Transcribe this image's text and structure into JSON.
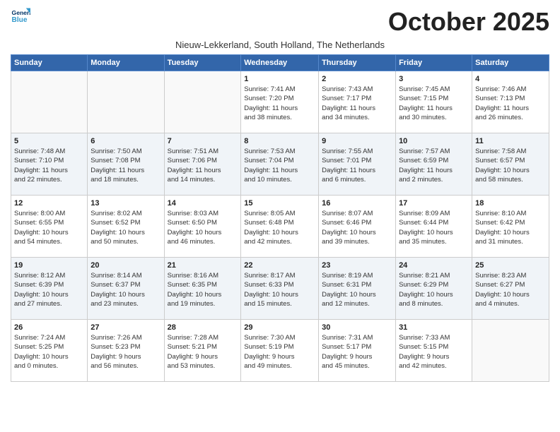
{
  "header": {
    "logo_line1": "General",
    "logo_line2": "Blue",
    "month": "October 2025",
    "subtitle": "Nieuw-Lekkerland, South Holland, The Netherlands"
  },
  "weekdays": [
    "Sunday",
    "Monday",
    "Tuesday",
    "Wednesday",
    "Thursday",
    "Friday",
    "Saturday"
  ],
  "weeks": [
    [
      {
        "day": "",
        "info": ""
      },
      {
        "day": "",
        "info": ""
      },
      {
        "day": "",
        "info": ""
      },
      {
        "day": "1",
        "info": "Sunrise: 7:41 AM\nSunset: 7:20 PM\nDaylight: 11 hours\nand 38 minutes."
      },
      {
        "day": "2",
        "info": "Sunrise: 7:43 AM\nSunset: 7:17 PM\nDaylight: 11 hours\nand 34 minutes."
      },
      {
        "day": "3",
        "info": "Sunrise: 7:45 AM\nSunset: 7:15 PM\nDaylight: 11 hours\nand 30 minutes."
      },
      {
        "day": "4",
        "info": "Sunrise: 7:46 AM\nSunset: 7:13 PM\nDaylight: 11 hours\nand 26 minutes."
      }
    ],
    [
      {
        "day": "5",
        "info": "Sunrise: 7:48 AM\nSunset: 7:10 PM\nDaylight: 11 hours\nand 22 minutes."
      },
      {
        "day": "6",
        "info": "Sunrise: 7:50 AM\nSunset: 7:08 PM\nDaylight: 11 hours\nand 18 minutes."
      },
      {
        "day": "7",
        "info": "Sunrise: 7:51 AM\nSunset: 7:06 PM\nDaylight: 11 hours\nand 14 minutes."
      },
      {
        "day": "8",
        "info": "Sunrise: 7:53 AM\nSunset: 7:04 PM\nDaylight: 11 hours\nand 10 minutes."
      },
      {
        "day": "9",
        "info": "Sunrise: 7:55 AM\nSunset: 7:01 PM\nDaylight: 11 hours\nand 6 minutes."
      },
      {
        "day": "10",
        "info": "Sunrise: 7:57 AM\nSunset: 6:59 PM\nDaylight: 11 hours\nand 2 minutes."
      },
      {
        "day": "11",
        "info": "Sunrise: 7:58 AM\nSunset: 6:57 PM\nDaylight: 10 hours\nand 58 minutes."
      }
    ],
    [
      {
        "day": "12",
        "info": "Sunrise: 8:00 AM\nSunset: 6:55 PM\nDaylight: 10 hours\nand 54 minutes."
      },
      {
        "day": "13",
        "info": "Sunrise: 8:02 AM\nSunset: 6:52 PM\nDaylight: 10 hours\nand 50 minutes."
      },
      {
        "day": "14",
        "info": "Sunrise: 8:03 AM\nSunset: 6:50 PM\nDaylight: 10 hours\nand 46 minutes."
      },
      {
        "day": "15",
        "info": "Sunrise: 8:05 AM\nSunset: 6:48 PM\nDaylight: 10 hours\nand 42 minutes."
      },
      {
        "day": "16",
        "info": "Sunrise: 8:07 AM\nSunset: 6:46 PM\nDaylight: 10 hours\nand 39 minutes."
      },
      {
        "day": "17",
        "info": "Sunrise: 8:09 AM\nSunset: 6:44 PM\nDaylight: 10 hours\nand 35 minutes."
      },
      {
        "day": "18",
        "info": "Sunrise: 8:10 AM\nSunset: 6:42 PM\nDaylight: 10 hours\nand 31 minutes."
      }
    ],
    [
      {
        "day": "19",
        "info": "Sunrise: 8:12 AM\nSunset: 6:39 PM\nDaylight: 10 hours\nand 27 minutes."
      },
      {
        "day": "20",
        "info": "Sunrise: 8:14 AM\nSunset: 6:37 PM\nDaylight: 10 hours\nand 23 minutes."
      },
      {
        "day": "21",
        "info": "Sunrise: 8:16 AM\nSunset: 6:35 PM\nDaylight: 10 hours\nand 19 minutes."
      },
      {
        "day": "22",
        "info": "Sunrise: 8:17 AM\nSunset: 6:33 PM\nDaylight: 10 hours\nand 15 minutes."
      },
      {
        "day": "23",
        "info": "Sunrise: 8:19 AM\nSunset: 6:31 PM\nDaylight: 10 hours\nand 12 minutes."
      },
      {
        "day": "24",
        "info": "Sunrise: 8:21 AM\nSunset: 6:29 PM\nDaylight: 10 hours\nand 8 minutes."
      },
      {
        "day": "25",
        "info": "Sunrise: 8:23 AM\nSunset: 6:27 PM\nDaylight: 10 hours\nand 4 minutes."
      }
    ],
    [
      {
        "day": "26",
        "info": "Sunrise: 7:24 AM\nSunset: 5:25 PM\nDaylight: 10 hours\nand 0 minutes."
      },
      {
        "day": "27",
        "info": "Sunrise: 7:26 AM\nSunset: 5:23 PM\nDaylight: 9 hours\nand 56 minutes."
      },
      {
        "day": "28",
        "info": "Sunrise: 7:28 AM\nSunset: 5:21 PM\nDaylight: 9 hours\nand 53 minutes."
      },
      {
        "day": "29",
        "info": "Sunrise: 7:30 AM\nSunset: 5:19 PM\nDaylight: 9 hours\nand 49 minutes."
      },
      {
        "day": "30",
        "info": "Sunrise: 7:31 AM\nSunset: 5:17 PM\nDaylight: 9 hours\nand 45 minutes."
      },
      {
        "day": "31",
        "info": "Sunrise: 7:33 AM\nSunset: 5:15 PM\nDaylight: 9 hours\nand 42 minutes."
      },
      {
        "day": "",
        "info": ""
      }
    ]
  ]
}
